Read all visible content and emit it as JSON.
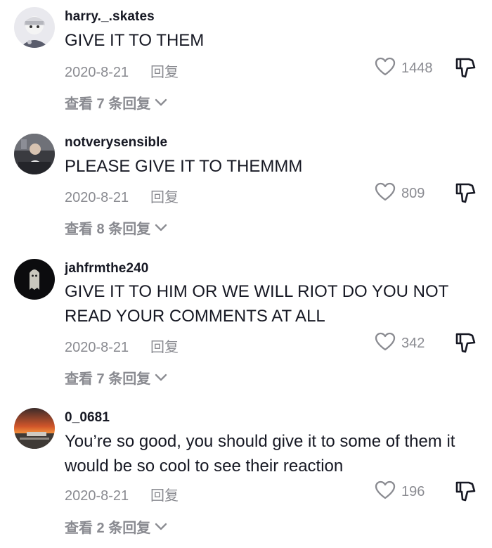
{
  "comments": [
    {
      "username": "harry._.skates",
      "text": "GIVE IT TO THEM",
      "date": "2020-8-21",
      "reply_label": "回复",
      "likes": "1448",
      "view_replies": "查看 7 条回复"
    },
    {
      "username": "notverysensible",
      "text": "PLEASE GIVE IT TO THEMMM",
      "date": "2020-8-21",
      "reply_label": "回复",
      "likes": "809",
      "view_replies": "查看 8 条回复"
    },
    {
      "username": "jahfrmthe240",
      "text": "GIVE IT TO HIM OR WE WILL RIOT DO YOU NOT READ YOUR COMMENTS AT ALL",
      "date": "2020-8-21",
      "reply_label": "回复",
      "likes": "342",
      "view_replies": "查看 7 条回复"
    },
    {
      "username": "0_0681",
      "text": "You’re so good, you should give it to some of them it would be so cool to see their reaction",
      "date": "2020-8-21",
      "reply_label": "回复",
      "likes": "196",
      "view_replies": "查看 2 条回复"
    }
  ],
  "icons": {
    "like": "heart-outline-icon",
    "dislike": "thumbs-down-outline-icon",
    "expand": "chevron-down-icon"
  },
  "colors": {
    "text": "#161823",
    "muted": "#8a8b91",
    "background": "#ffffff"
  }
}
